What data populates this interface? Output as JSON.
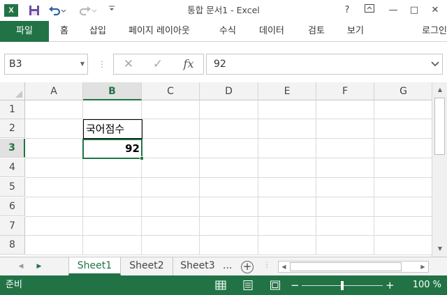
{
  "titlebar": {
    "title": "통합 문서1 - Excel",
    "help": "?",
    "ribbon_display": "⧉",
    "minimize": "—",
    "maximize": "□",
    "close": "✕"
  },
  "qat": {
    "app_icon": "excel-logo-icon",
    "save_icon": "save-icon",
    "undo_icon": "undo-icon",
    "redo_icon": "redo-icon",
    "customize_icon": "customize-qat-icon"
  },
  "tabs": {
    "file": "파일",
    "items": [
      "홈",
      "삽입",
      "페이지 레이아웃",
      "수식",
      "데이터",
      "검토",
      "보기"
    ],
    "signin": "로그인"
  },
  "formula_bar": {
    "name_box": "B3",
    "formula": "92",
    "cancel_icon": "✕",
    "enter_icon": "✓",
    "fx": "fx"
  },
  "sheet": {
    "columns": [
      "A",
      "B",
      "C",
      "D",
      "E",
      "F",
      "G"
    ],
    "selected_column": "B",
    "rows": [
      "1",
      "2",
      "3",
      "4",
      "5",
      "6",
      "7",
      "8"
    ],
    "selected_row": "3",
    "cells": {
      "B2": "국어점수",
      "B3": "92"
    },
    "active_cell": "B3"
  },
  "sheet_tabs": {
    "tabs": [
      "Sheet1",
      "Sheet2",
      "Sheet3"
    ],
    "active": "Sheet1",
    "more": "...",
    "add": "+"
  },
  "status_bar": {
    "status": "준비",
    "zoom_minus": "−",
    "zoom_plus": "+",
    "zoom": "100 %",
    "zoom_value_percent": 100
  },
  "colors": {
    "accent": "#217346",
    "header_bg": "#f3f3f3",
    "selected_header_bg": "#e1e1e1"
  }
}
